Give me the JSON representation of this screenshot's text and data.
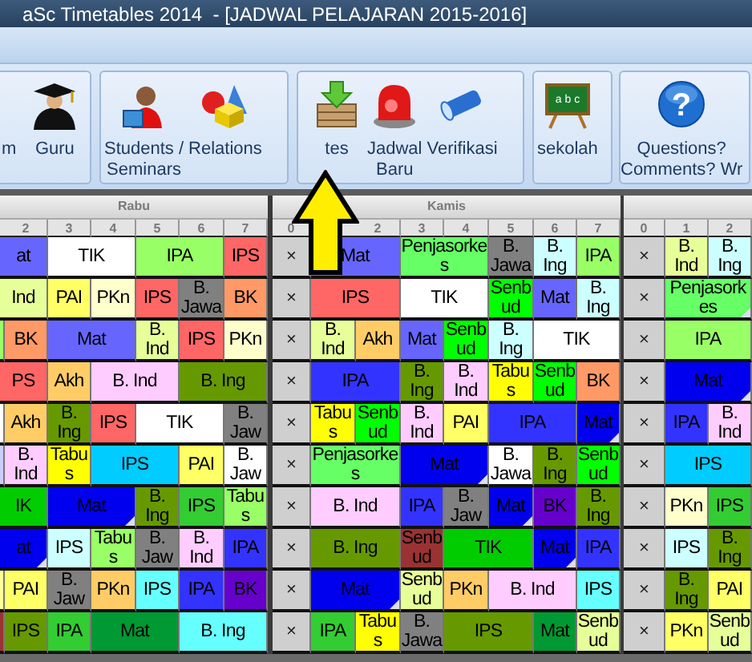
{
  "window": {
    "title": "aSc Timetables 2014  - [JADWAL PELAJARAN 2015-2016]"
  },
  "ribbon": {
    "groups": [
      {
        "buttons": [
          {
            "label": "m"
          },
          {
            "label": "Guru"
          }
        ]
      },
      {
        "buttons": [
          {
            "label": "Students /\nSeminars"
          },
          {
            "label": "Relations"
          }
        ]
      },
      {
        "buttons": [
          {
            "label": "tes"
          },
          {
            "label": "Jadwal\nBaru"
          },
          {
            "label": "Verifikasi"
          }
        ]
      },
      {
        "buttons": [
          {
            "label": "sekolah",
            "glyph": "a b c"
          }
        ]
      },
      {
        "buttons": [
          {
            "label": "Questions?\nComments? Wr",
            "glyph": "?"
          }
        ]
      }
    ]
  },
  "days": [
    {
      "name": "Rabu",
      "periods": [
        "2",
        "3",
        "4",
        "5",
        "6",
        "7"
      ],
      "rows": [
        [
          {
            "kind": "double",
            "text": "at",
            "color": "#6666ff",
            "marked": false
          },
          {
            "kind": "double",
            "text": "TIK",
            "color": "#ffffff",
            "marked": false
          },
          {
            "kind": "double",
            "text": "IPA",
            "color": "#99ff66",
            "marked": false
          },
          {
            "kind": "single",
            "text": "IPS",
            "color": "#ff6666",
            "marked": false
          }
        ],
        [
          {
            "kind": "double",
            "text": "Ind",
            "color": "#e6ff99",
            "marked": false
          },
          {
            "kind": "single",
            "text": "PAI",
            "color": "#ffff66",
            "marked": false
          },
          {
            "kind": "single",
            "text": "PKn",
            "color": "#ffffcc",
            "marked": false
          },
          {
            "kind": "single",
            "text": "IPS",
            "color": "#ff6666",
            "marked": false
          },
          {
            "kind": "single",
            "text": "B. Jawa",
            "color": "#808080",
            "marked": false
          },
          {
            "kind": "single",
            "text": "BK",
            "color": "#ff9966",
            "marked": false
          }
        ],
        [
          {
            "kind": "single",
            "color": "#99ff66",
            "marked": false
          },
          {
            "kind": "single",
            "text": "BK",
            "color": "#ff9966",
            "marked": false
          },
          {
            "kind": "double",
            "text": "Mat",
            "color": "#6666ff",
            "marked": false
          },
          {
            "kind": "single",
            "text": "B. Ind",
            "color": "#e6ff99",
            "marked": false
          },
          {
            "kind": "single",
            "text": "IPS",
            "color": "#ff6666",
            "marked": false
          },
          {
            "kind": "single",
            "text": "PKn",
            "color": "#ffffcc",
            "marked": false
          }
        ],
        [
          {
            "kind": "double",
            "text": "PS",
            "color": "#ff6666",
            "marked": false
          },
          {
            "kind": "single",
            "text": "Akh",
            "color": "#ffcc66",
            "marked": false
          },
          {
            "kind": "double",
            "text": "B. Ind",
            "color": "#ffccff",
            "marked": false
          },
          {
            "kind": "double",
            "text": "B. Ing",
            "color": "#669900",
            "marked": false
          }
        ],
        [
          {
            "kind": "single",
            "color": "#ffffff",
            "marked": false
          },
          {
            "kind": "single",
            "text": "Akh",
            "color": "#ffcc66",
            "marked": false
          },
          {
            "kind": "single",
            "text": "B. Ing",
            "color": "#669900",
            "marked": false
          },
          {
            "kind": "single",
            "text": "IPS",
            "color": "#ff6666",
            "marked": false
          },
          {
            "kind": "double",
            "text": "TIK",
            "color": "#ffffff",
            "marked": false
          },
          {
            "kind": "single",
            "text": "B. Jaw",
            "color": "#808080",
            "marked": false
          }
        ],
        [
          {
            "kind": "single",
            "color": "#ccccff",
            "marked": false
          },
          {
            "kind": "single",
            "text": "B. Ind",
            "color": "#ffccff",
            "marked": false
          },
          {
            "kind": "single",
            "text": "Tabus",
            "color": "#ffff00",
            "marked": false
          },
          {
            "kind": "double",
            "text": "IPS",
            "color": "#00ccff",
            "marked": false
          },
          {
            "kind": "single",
            "text": "PAI",
            "color": "#ffff66",
            "marked": false
          },
          {
            "kind": "single",
            "text": "B. Jaw",
            "color": "#ffffff",
            "marked": false
          }
        ],
        [
          {
            "kind": "double",
            "text": "IK",
            "color": "#00cc00",
            "marked": false
          },
          {
            "kind": "double",
            "text": "Mat",
            "color": "#0000ee",
            "marked": true
          },
          {
            "kind": "single",
            "text": "B. Ing",
            "color": "#669900",
            "marked": false
          },
          {
            "kind": "single",
            "text": "IPS",
            "color": "#33cc33",
            "marked": false
          },
          {
            "kind": "single",
            "text": "Tabus",
            "color": "#99ff66",
            "marked": false
          }
        ],
        [
          {
            "kind": "double",
            "text": "at",
            "color": "#0000ee",
            "marked": true
          },
          {
            "kind": "single",
            "text": "IPS",
            "color": "#ccffff",
            "marked": false
          },
          {
            "kind": "single",
            "text": "Tabus",
            "color": "#99ff66",
            "marked": false
          },
          {
            "kind": "single",
            "text": "B. Jaw",
            "color": "#808080",
            "marked": false
          },
          {
            "kind": "single",
            "text": "B. Ind",
            "color": "#ffccff",
            "marked": false
          },
          {
            "kind": "single",
            "text": "IPA",
            "color": "#3333ff",
            "marked": false
          }
        ],
        [
          {
            "kind": "single",
            "color": "#ffff99",
            "marked": false
          },
          {
            "kind": "single",
            "text": "PAI",
            "color": "#ffff66",
            "marked": false
          },
          {
            "kind": "single",
            "text": "B. Jaw",
            "color": "#808080",
            "marked": false
          },
          {
            "kind": "single",
            "text": "PKn",
            "color": "#ffcc66",
            "marked": false
          },
          {
            "kind": "single",
            "text": "IPS",
            "color": "#66ffff",
            "marked": false
          },
          {
            "kind": "single",
            "text": "IPA",
            "color": "#3333ff",
            "marked": false
          },
          {
            "kind": "single",
            "text": "BK",
            "color": "#6600cc",
            "marked": false
          }
        ],
        [
          {
            "kind": "single",
            "color": "#993333",
            "marked": false
          },
          {
            "kind": "single",
            "text": "IPS",
            "color": "#669900",
            "marked": false
          },
          {
            "kind": "single",
            "text": "IPA",
            "color": "#33cc33",
            "marked": false
          },
          {
            "kind": "double",
            "text": "Mat",
            "color": "#009933",
            "marked": false
          },
          {
            "kind": "double",
            "text": "B. Ing",
            "color": "#66ffff",
            "marked": false
          }
        ]
      ]
    },
    {
      "name": "Kamis",
      "periods": [
        "0",
        "2",
        "3",
        "4",
        "5",
        "6",
        "7"
      ],
      "rows": [
        [
          {
            "kind": "blocked",
            "text": "×"
          },
          {
            "kind": "double",
            "text": "Mat",
            "color": "#6666ff",
            "marked": false
          },
          {
            "kind": "double",
            "text": "Penjasorkes",
            "color": "#66ff66",
            "marked": false
          },
          {
            "kind": "single",
            "text": "B. Jawa",
            "color": "#808080",
            "marked": false
          },
          {
            "kind": "single",
            "text": "B. Ing",
            "color": "#ccffff",
            "marked": false
          },
          {
            "kind": "single",
            "text": "IPA",
            "color": "#99ff66",
            "marked": false
          }
        ],
        [
          {
            "kind": "blocked",
            "text": "×"
          },
          {
            "kind": "double",
            "text": "IPS",
            "color": "#ff6666",
            "marked": false
          },
          {
            "kind": "double",
            "text": "TIK",
            "color": "#ffffff",
            "marked": false
          },
          {
            "kind": "single",
            "text": "Senbud",
            "color": "#00ff00",
            "marked": false
          },
          {
            "kind": "single",
            "text": "Mat",
            "color": "#6666ff",
            "marked": false
          },
          {
            "kind": "single",
            "text": "B. Ing",
            "color": "#ccffff",
            "marked": false
          }
        ],
        [
          {
            "kind": "blocked",
            "text": "×"
          },
          {
            "kind": "single",
            "text": "B. Ind",
            "color": "#e6ff99",
            "marked": false
          },
          {
            "kind": "single",
            "text": "Akh",
            "color": "#ffcc66",
            "marked": false
          },
          {
            "kind": "single",
            "text": "Mat",
            "color": "#6666ff",
            "marked": false
          },
          {
            "kind": "single",
            "text": "Senbud",
            "color": "#00ff00",
            "marked": false
          },
          {
            "kind": "single",
            "text": "B. Ing",
            "color": "#ccffff",
            "marked": false
          },
          {
            "kind": "double",
            "text": "TIK",
            "color": "#ffffff",
            "marked": false
          }
        ],
        [
          {
            "kind": "blocked",
            "text": "×"
          },
          {
            "kind": "double",
            "text": "IPA",
            "color": "#3333ff",
            "marked": false
          },
          {
            "kind": "single",
            "text": "B. Ing",
            "color": "#669900",
            "marked": false
          },
          {
            "kind": "single",
            "text": "B. Ind",
            "color": "#ffccff",
            "marked": false
          },
          {
            "kind": "single",
            "text": "Tabus",
            "color": "#ffff00",
            "marked": false
          },
          {
            "kind": "single",
            "text": "Senbud",
            "color": "#00ff00",
            "marked": false
          },
          {
            "kind": "single",
            "text": "BK",
            "color": "#ff9966",
            "marked": false
          }
        ],
        [
          {
            "kind": "blocked",
            "text": "×"
          },
          {
            "kind": "single",
            "text": "Tabus",
            "color": "#ffff00",
            "marked": false
          },
          {
            "kind": "single",
            "text": "Senbud",
            "color": "#00ff00",
            "marked": false
          },
          {
            "kind": "single",
            "text": "B. Ind",
            "color": "#ffccff",
            "marked": false
          },
          {
            "kind": "single",
            "text": "PAI",
            "color": "#ffff66",
            "marked": false
          },
          {
            "kind": "double",
            "text": "IPA",
            "color": "#3333ff",
            "marked": false
          },
          {
            "kind": "single",
            "text": "Mat",
            "color": "#0000ee",
            "marked": true
          }
        ],
        [
          {
            "kind": "blocked",
            "text": "×"
          },
          {
            "kind": "double",
            "text": "Penjasorkes",
            "color": "#66ff66",
            "marked": false
          },
          {
            "kind": "double",
            "text": "Mat",
            "color": "#0000ee",
            "marked": true
          },
          {
            "kind": "single",
            "text": "B. Jawa",
            "color": "#ffffff",
            "marked": false
          },
          {
            "kind": "single",
            "text": "B. Ing",
            "color": "#669900",
            "marked": false
          },
          {
            "kind": "single",
            "text": "Senbud",
            "color": "#00ff00",
            "marked": false
          }
        ],
        [
          {
            "kind": "blocked",
            "text": "×"
          },
          {
            "kind": "double",
            "text": "B. Ind",
            "color": "#ffccff",
            "marked": false
          },
          {
            "kind": "single",
            "text": "IPA",
            "color": "#3333ff",
            "marked": false
          },
          {
            "kind": "single",
            "text": "B. Jaw",
            "color": "#808080",
            "marked": false
          },
          {
            "kind": "single",
            "text": "Mat",
            "color": "#0000ee",
            "marked": true
          },
          {
            "kind": "single",
            "text": "BK",
            "color": "#6600cc",
            "marked": false
          },
          {
            "kind": "single",
            "text": "B. Ing",
            "color": "#669900",
            "marked": false
          }
        ],
        [
          {
            "kind": "blocked",
            "text": "×"
          },
          {
            "kind": "double",
            "text": "B. Ing",
            "color": "#669900",
            "marked": false
          },
          {
            "kind": "single",
            "text": "Senbud",
            "color": "#993333",
            "marked": false
          },
          {
            "kind": "double",
            "text": "TIK",
            "color": "#00cc00",
            "marked": false
          },
          {
            "kind": "single",
            "text": "Mat",
            "color": "#0000ee",
            "marked": true
          },
          {
            "kind": "single",
            "text": "IPA",
            "color": "#3333ff",
            "marked": false
          }
        ],
        [
          {
            "kind": "blocked",
            "text": "×"
          },
          {
            "kind": "double",
            "text": "Mat",
            "color": "#0000ee",
            "marked": true
          },
          {
            "kind": "single",
            "text": "Senbud",
            "color": "#e6ff99",
            "marked": false
          },
          {
            "kind": "single",
            "text": "PKn",
            "color": "#ffcc66",
            "marked": false
          },
          {
            "kind": "double",
            "text": "B. Ind",
            "color": "#ffccff",
            "marked": false
          },
          {
            "kind": "single",
            "text": "IPS",
            "color": "#66ffff",
            "marked": false
          }
        ],
        [
          {
            "kind": "blocked",
            "text": "×"
          },
          {
            "kind": "single",
            "text": "IPA",
            "color": "#33cc33",
            "marked": false
          },
          {
            "kind": "single",
            "text": "Tabus",
            "color": "#ffff00",
            "marked": false
          },
          {
            "kind": "single",
            "text": "B. Jawa",
            "color": "#808080",
            "marked": false
          },
          {
            "kind": "double",
            "text": "IPS",
            "color": "#669900",
            "marked": false
          },
          {
            "kind": "single",
            "text": "Mat",
            "color": "#009933",
            "marked": false
          },
          {
            "kind": "single",
            "text": "Senbud",
            "color": "#e6ff99",
            "marked": false
          }
        ]
      ]
    },
    {
      "periods": [
        "0",
        "1",
        "2"
      ],
      "rows": [
        [
          {
            "kind": "blocked",
            "text": "×"
          },
          {
            "kind": "single",
            "text": "B. Ind",
            "color": "#e6ff99",
            "marked": false
          },
          {
            "kind": "single",
            "text": "B. Ing",
            "color": "#ccffff",
            "marked": false
          }
        ],
        [
          {
            "kind": "blocked",
            "text": "×"
          },
          {
            "kind": "double",
            "text": "Penjasorkes",
            "color": "#66ff66",
            "marked": true
          }
        ],
        [
          {
            "kind": "blocked",
            "text": "×"
          },
          {
            "kind": "double",
            "text": "IPA",
            "color": "#99ff66",
            "marked": false
          }
        ],
        [
          {
            "kind": "blocked",
            "text": "×"
          },
          {
            "kind": "double",
            "text": "Mat",
            "color": "#0000ee",
            "marked": true
          }
        ],
        [
          {
            "kind": "blocked",
            "text": "×"
          },
          {
            "kind": "single",
            "text": "IPA",
            "color": "#3333ff",
            "marked": false
          },
          {
            "kind": "single",
            "text": "B. Ind",
            "color": "#ffccff",
            "marked": false
          }
        ],
        [
          {
            "kind": "blocked",
            "text": "×"
          },
          {
            "kind": "double",
            "text": "IPS",
            "color": "#00ccff",
            "marked": false
          }
        ],
        [
          {
            "kind": "blocked",
            "text": "×"
          },
          {
            "kind": "single",
            "text": "PKn",
            "color": "#ffffcc",
            "marked": false
          },
          {
            "kind": "single",
            "text": "IPS",
            "color": "#33cc33",
            "marked": false
          }
        ],
        [
          {
            "kind": "blocked",
            "text": "×"
          },
          {
            "kind": "single",
            "text": "IPS",
            "color": "#ccffff",
            "marked": false
          },
          {
            "kind": "single",
            "text": "B. Ing",
            "color": "#669900",
            "marked": false
          }
        ],
        [
          {
            "kind": "blocked",
            "text": "×"
          },
          {
            "kind": "single",
            "text": "B. Ing",
            "color": "#669900",
            "marked": false
          },
          {
            "kind": "single",
            "text": "PAI",
            "color": "#ffff66",
            "marked": false
          }
        ],
        [
          {
            "kind": "blocked",
            "text": "×"
          },
          {
            "kind": "single",
            "text": "PKn",
            "color": "#ffff66",
            "marked": false
          },
          {
            "kind": "single",
            "text": "Senbud",
            "color": "#e6ff99",
            "marked": false
          }
        ]
      ]
    }
  ]
}
